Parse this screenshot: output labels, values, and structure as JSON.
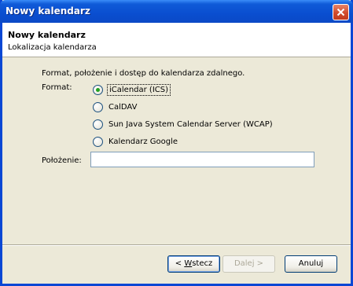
{
  "window": {
    "title": "Nowy kalendarz"
  },
  "header": {
    "title": "Nowy kalendarz",
    "subtitle": "Lokalizacja kalendarza"
  },
  "form": {
    "description": "Format, położenie i dostęp do kalendarza zdalnego.",
    "format_label": "Format:",
    "options": [
      {
        "label": "iCalendar (ICS)",
        "selected": true
      },
      {
        "label": "CalDAV",
        "selected": false
      },
      {
        "label": "Sun Java System Calendar Server (WCAP)",
        "selected": false
      },
      {
        "label": "Kalendarz Google",
        "selected": false
      }
    ],
    "location_label": "Położenie:",
    "location_value": ""
  },
  "buttons": {
    "back": {
      "prefix": "< ",
      "accesskey": "W",
      "rest": "stecz"
    },
    "next": {
      "label": "Dalej >"
    },
    "cancel": {
      "label": "Anuluj"
    }
  },
  "colors": {
    "titlebar": "#0a4ed0",
    "dialog_bg": "#ece9d8",
    "radio_dot": "#21a121",
    "close_button": "#d24b2c"
  },
  "icons": {
    "close": "close-icon"
  }
}
